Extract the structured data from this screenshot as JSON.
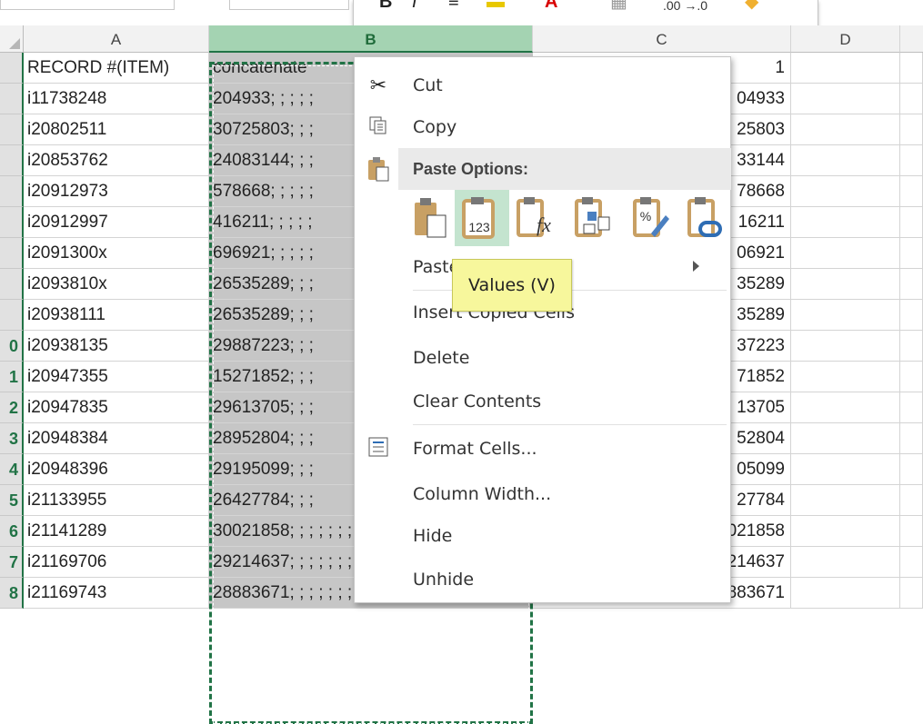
{
  "columns": {
    "a": "A",
    "b": "B",
    "c": "C",
    "d": "D"
  },
  "row_labels": [
    "",
    "",
    "",
    "",
    "",
    "",
    "",
    "",
    "0",
    "1",
    "2",
    "3",
    "4",
    "5",
    "6",
    "7",
    "8"
  ],
  "rows": [
    {
      "a": "RECORD #(ITEM)",
      "b": "concatenate",
      "c": "1"
    },
    {
      "a": "i11738248",
      "b": "204933; ; ; ; ;",
      "c": "04933"
    },
    {
      "a": "i20802511",
      "b": "30725803; ; ;",
      "c": "25803"
    },
    {
      "a": "i20853762",
      "b": "24083144; ; ;",
      "c": "33144"
    },
    {
      "a": "i20912973",
      "b": "578668; ; ; ; ;",
      "c": "78668"
    },
    {
      "a": "i20912997",
      "b": "416211; ; ; ; ;",
      "c": "16211"
    },
    {
      "a": "i2091300x",
      "b": "696921; ; ; ; ;",
      "c": "06921"
    },
    {
      "a": "i2093810x",
      "b": "26535289; ; ;",
      "c": "35289"
    },
    {
      "a": "i20938111",
      "b": "26535289; ; ;",
      "c": "35289"
    },
    {
      "a": "i20938135",
      "b": "29887223; ; ;",
      "c": "37223"
    },
    {
      "a": "i20947355",
      "b": "15271852; ; ;",
      "c": "71852"
    },
    {
      "a": "i20947835",
      "b": "29613705; ; ;",
      "c": "13705"
    },
    {
      "a": "i20948384",
      "b": "28952804; ; ;",
      "c": "52804"
    },
    {
      "a": "i20948396",
      "b": "29195099; ; ;",
      "c": "05099"
    },
    {
      "a": "i21133955",
      "b": "26427784; ; ;",
      "c": "27784"
    },
    {
      "a": "i21141289",
      "b": "30021858; ; ; ; ; ; ; ; ; ; ; ; ; ; ; ; ; ; ;",
      "c": "30021858"
    },
    {
      "a": "i21169706",
      "b": "29214637; ; ; ; ; ; ; ; ; ; ; ; ; ; ; ; ; ; ;",
      "c": "29214637"
    },
    {
      "a": "i21169743",
      "b": "28883671; ; ; ; ; ; ; ; ; ; ; ; ; ; ; ; ; ; ;",
      "c": "28883671"
    }
  ],
  "context_menu": {
    "cut": "Cut",
    "copy": "Copy",
    "paste_options": "Paste Options:",
    "paste_special": "Paste Special...",
    "insert_copied": "Insert Copied Cells",
    "delete": "Delete",
    "clear_contents": "Clear Contents",
    "format_cells": "Format Cells...",
    "column_width": "Column Width...",
    "hide": "Hide",
    "unhide": "Unhide"
  },
  "tooltip": "Values (V)",
  "mini_toolbar": {
    "bold": "B",
    "italic": "I",
    "decimals": ".00 →.0"
  },
  "colors": {
    "accent": "#217346",
    "selected_fill": "#c6c6c6",
    "tooltip": "#f7f79c"
  }
}
